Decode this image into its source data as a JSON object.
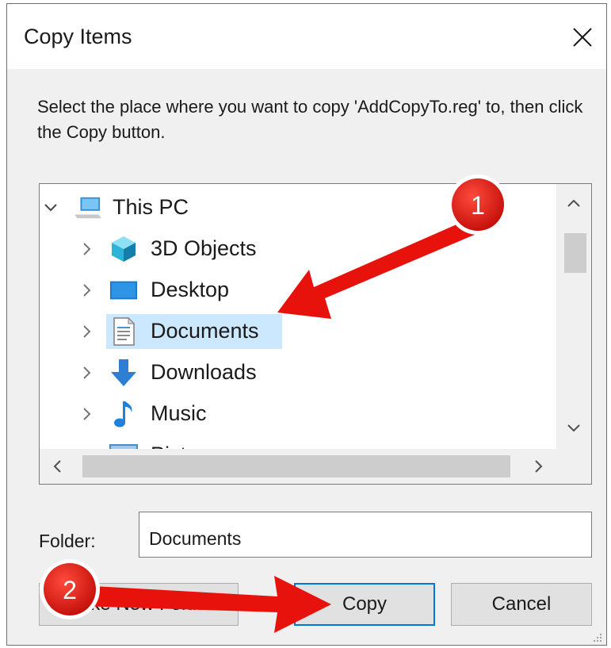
{
  "dialog": {
    "title": "Copy Items",
    "instructions": "Select the place where you want to copy 'AddCopyTo.reg' to, then click the Copy button."
  },
  "tree": {
    "root": {
      "label": "This PC",
      "expanded": true,
      "icon": "computer-icon"
    },
    "items": [
      {
        "label": "3D Objects",
        "icon": "cube-3d-icon"
      },
      {
        "label": "Desktop",
        "icon": "desktop-icon"
      },
      {
        "label": "Documents",
        "icon": "documents-icon",
        "selected": true
      },
      {
        "label": "Downloads",
        "icon": "download-arrow-icon"
      },
      {
        "label": "Music",
        "icon": "music-note-icon"
      },
      {
        "label": "Pict",
        "icon": "pictures-icon"
      }
    ]
  },
  "folder": {
    "label": "Folder:",
    "value": "Documents"
  },
  "buttons": {
    "new_folder": "Make New Folder",
    "copy": "Copy",
    "cancel": "Cancel"
  },
  "annotations": [
    {
      "number": "1"
    },
    {
      "number": "2"
    }
  ],
  "colors": {
    "selection": "#cce8ff",
    "accent": "#0078d7",
    "annotation_red": "#e8120c"
  }
}
